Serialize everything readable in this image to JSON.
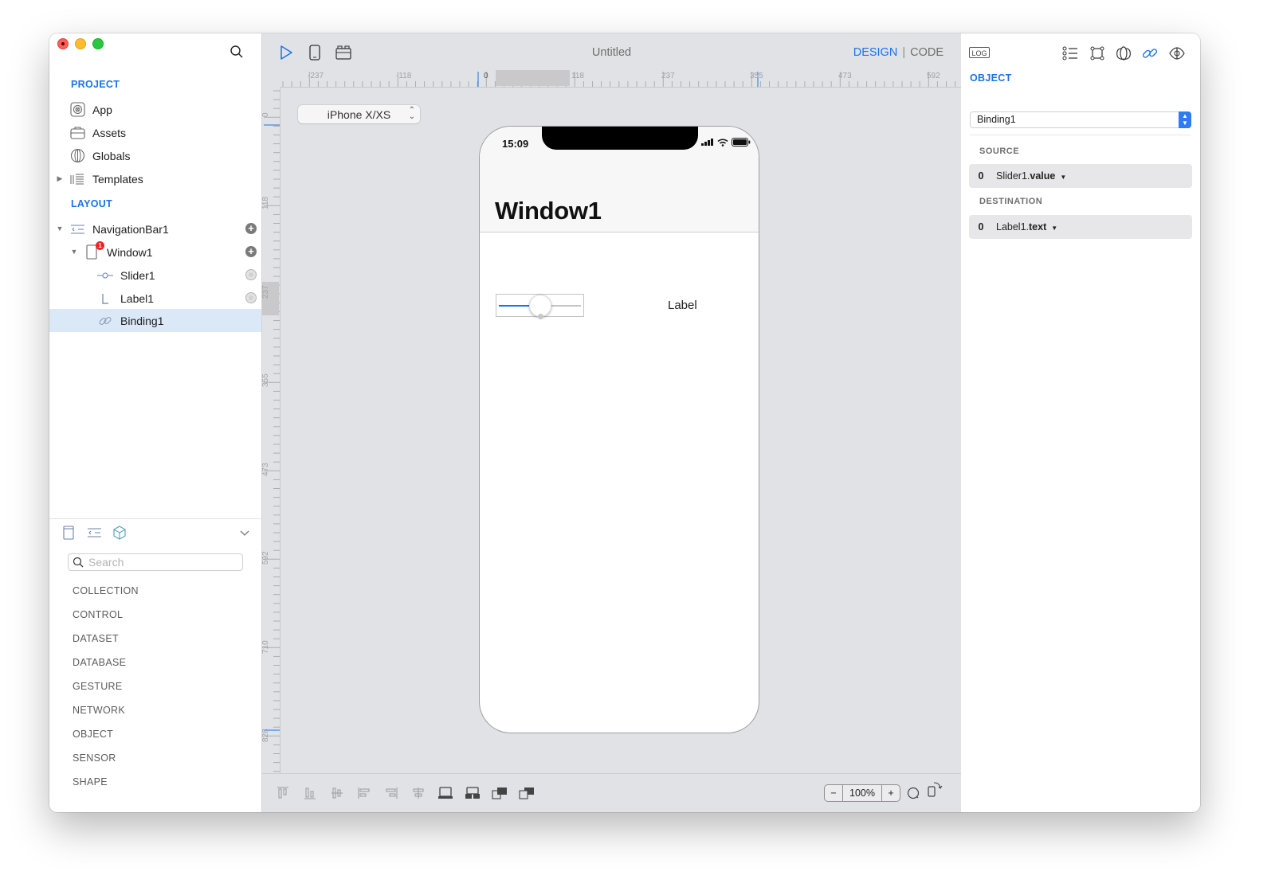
{
  "window": {
    "title": "Untitled",
    "controls": [
      "close",
      "minimize",
      "zoom"
    ]
  },
  "sidebar": {
    "project_title": "PROJECT",
    "project_items": [
      {
        "label": "App",
        "icon": "app-icon"
      },
      {
        "label": "Assets",
        "icon": "briefcase-icon"
      },
      {
        "label": "Globals",
        "icon": "globe-icon"
      },
      {
        "label": "Templates",
        "icon": "templates-icon",
        "collapsed": true
      }
    ],
    "layout_title": "LAYOUT",
    "layout_items": [
      {
        "label": "NavigationBar1",
        "icon": "navigation-bar-icon",
        "expanded": true,
        "action": "add"
      },
      {
        "label": "Window1",
        "icon": "window-icon",
        "expanded": true,
        "badge": "1",
        "action": "add"
      },
      {
        "label": "Slider1",
        "icon": "slider-icon",
        "action": "visibility"
      },
      {
        "label": "Label1",
        "icon": "label-icon",
        "action": "visibility"
      },
      {
        "label": "Binding1",
        "icon": "link-icon",
        "selected": true
      }
    ],
    "library": {
      "search_placeholder": "Search",
      "search_value": "",
      "categories": [
        "COLLECTION",
        "CONTROL",
        "DATASET",
        "DATABASE",
        "GESTURE",
        "NETWORK",
        "OBJECT",
        "SENSOR",
        "SHAPE"
      ]
    }
  },
  "toolbar": {
    "design_label": "DESIGN",
    "separator": "|",
    "code_label": "CODE",
    "active_mode": "DESIGN"
  },
  "canvas": {
    "ruler_h": [
      "-237",
      "-118",
      "0",
      "118",
      "237",
      "355",
      "473",
      "592"
    ],
    "ruler_v": [
      "0",
      "118",
      "237",
      "355",
      "473",
      "592",
      "710",
      "828"
    ],
    "device": "iPhone X/XS",
    "phone": {
      "time": "15:09",
      "nav_title": "Window1",
      "slider_value": 0.5,
      "label_text": "Label"
    },
    "zoom": {
      "minus": "−",
      "value": "100%",
      "plus": "+"
    }
  },
  "inspector": {
    "log_label": "LOG",
    "section_title": "OBJECT",
    "selected_object": "Binding1",
    "source_label": "SOURCE",
    "source": {
      "index": "0",
      "object": "Slider1.",
      "property": "value"
    },
    "destination_label": "DESTINATION",
    "destination": {
      "index": "0",
      "object": "Label1.",
      "property": "text"
    }
  },
  "colors": {
    "accent": "#1a73e8",
    "selection": "#dbe8f8",
    "canvas_bg": "#e1e2e6"
  }
}
